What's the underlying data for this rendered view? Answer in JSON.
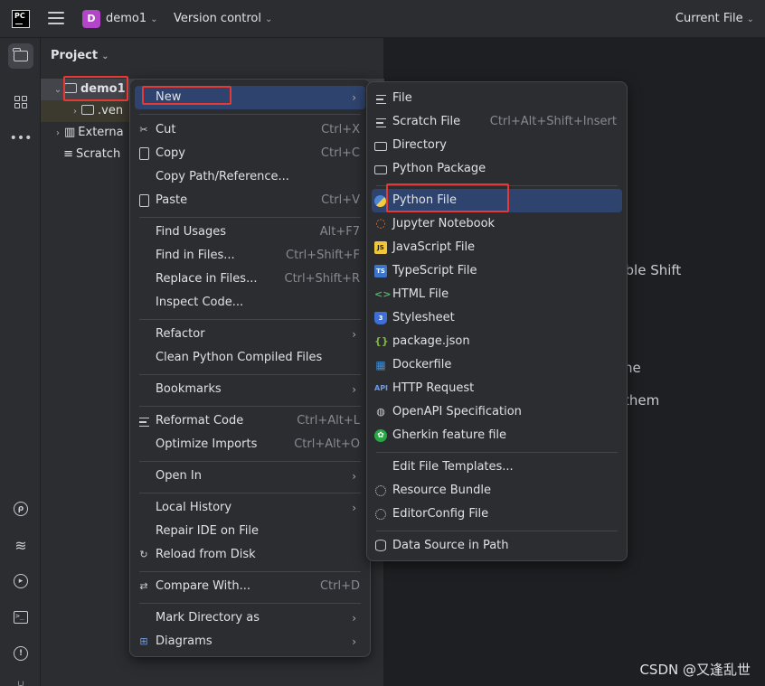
{
  "titlebar": {
    "logo_text": "PC",
    "project_badge": "D",
    "project_name": "demo1",
    "vcs_label": "Version control",
    "run_config": "Current File"
  },
  "project_panel": {
    "title": "Project",
    "tree": [
      {
        "label": "demo1",
        "expanded": true
      },
      {
        "label": ".ven",
        "expanded": false
      },
      {
        "label": "Externa",
        "expanded": false
      },
      {
        "label": "Scratch",
        "expanded": false
      }
    ]
  },
  "editor_hints": {
    "double_shift": "uble Shift",
    "line2": "ne",
    "line3": "them"
  },
  "context_menu": {
    "items": [
      {
        "label": "New",
        "shortcut": "",
        "submenu": true,
        "highlighted": true
      },
      {
        "label": "Cut",
        "shortcut": "Ctrl+X",
        "icon": "scissors-icon"
      },
      {
        "label": "Copy",
        "shortcut": "Ctrl+C",
        "icon": "copy-icon"
      },
      {
        "label": "Copy Path/Reference...",
        "shortcut": ""
      },
      {
        "label": "Paste",
        "shortcut": "Ctrl+V",
        "icon": "clipboard-icon"
      },
      {
        "label": "Find Usages",
        "shortcut": "Alt+F7"
      },
      {
        "label": "Find in Files...",
        "shortcut": "Ctrl+Shift+F"
      },
      {
        "label": "Replace in Files...",
        "shortcut": "Ctrl+Shift+R"
      },
      {
        "label": "Inspect Code...",
        "shortcut": ""
      },
      {
        "label": "Refactor",
        "submenu": true
      },
      {
        "label": "Clean Python Compiled Files",
        "shortcut": ""
      },
      {
        "label": "Bookmarks",
        "submenu": true
      },
      {
        "label": "Reformat Code",
        "shortcut": "Ctrl+Alt+L",
        "icon": "reformat-icon"
      },
      {
        "label": "Optimize Imports",
        "shortcut": "Ctrl+Alt+O"
      },
      {
        "label": "Open In",
        "submenu": true
      },
      {
        "label": "Local History",
        "submenu": true
      },
      {
        "label": "Repair IDE on File",
        "shortcut": ""
      },
      {
        "label": "Reload from Disk",
        "shortcut": "",
        "icon": "reload-icon"
      },
      {
        "label": "Compare With...",
        "shortcut": "Ctrl+D",
        "icon": "compare-icon"
      },
      {
        "label": "Mark Directory as",
        "submenu": true
      },
      {
        "label": "Diagrams",
        "submenu": true,
        "icon": "diagram-icon"
      }
    ]
  },
  "new_submenu": {
    "items": [
      {
        "label": "File",
        "shortcut": "",
        "icon": "file-lines-icon"
      },
      {
        "label": "Scratch File",
        "shortcut": "Ctrl+Alt+Shift+Insert",
        "icon": "scratch-file-icon"
      },
      {
        "label": "Directory",
        "shortcut": "",
        "icon": "folder-icon"
      },
      {
        "label": "Python Package",
        "shortcut": "",
        "icon": "package-folder-icon"
      },
      {
        "label": "Python File",
        "shortcut": "",
        "icon": "python-icon",
        "highlighted": true
      },
      {
        "label": "Jupyter Notebook",
        "shortcut": "",
        "icon": "jupyter-icon"
      },
      {
        "label": "JavaScript File",
        "shortcut": "",
        "icon": "javascript-icon",
        "badge": "JS"
      },
      {
        "label": "TypeScript File",
        "shortcut": "",
        "icon": "typescript-icon",
        "badge": "TS"
      },
      {
        "label": "HTML File",
        "shortcut": "",
        "icon": "html-icon"
      },
      {
        "label": "Stylesheet",
        "shortcut": "",
        "icon": "css-icon"
      },
      {
        "label": "package.json",
        "shortcut": "",
        "icon": "npm-json-icon"
      },
      {
        "label": "Dockerfile",
        "shortcut": "",
        "icon": "docker-icon"
      },
      {
        "label": "HTTP Request",
        "shortcut": "",
        "icon": "api-icon",
        "badge": "API"
      },
      {
        "label": "OpenAPI Specification",
        "shortcut": "",
        "icon": "openapi-icon"
      },
      {
        "label": "Gherkin feature file",
        "shortcut": "",
        "icon": "gherkin-icon"
      },
      {
        "label": "Edit File Templates...",
        "shortcut": ""
      },
      {
        "label": "Resource Bundle",
        "shortcut": "",
        "icon": "resource-bundle-icon"
      },
      {
        "label": "EditorConfig File",
        "shortcut": "",
        "icon": "editorconfig-icon"
      },
      {
        "label": "Data Source in Path",
        "shortcut": "",
        "icon": "database-icon"
      }
    ]
  },
  "watermark": "CSDN @又逢乱世",
  "colors": {
    "highlight": "#2e436e",
    "annotation_red": "#e53935",
    "project_badge": "#b345c9"
  }
}
